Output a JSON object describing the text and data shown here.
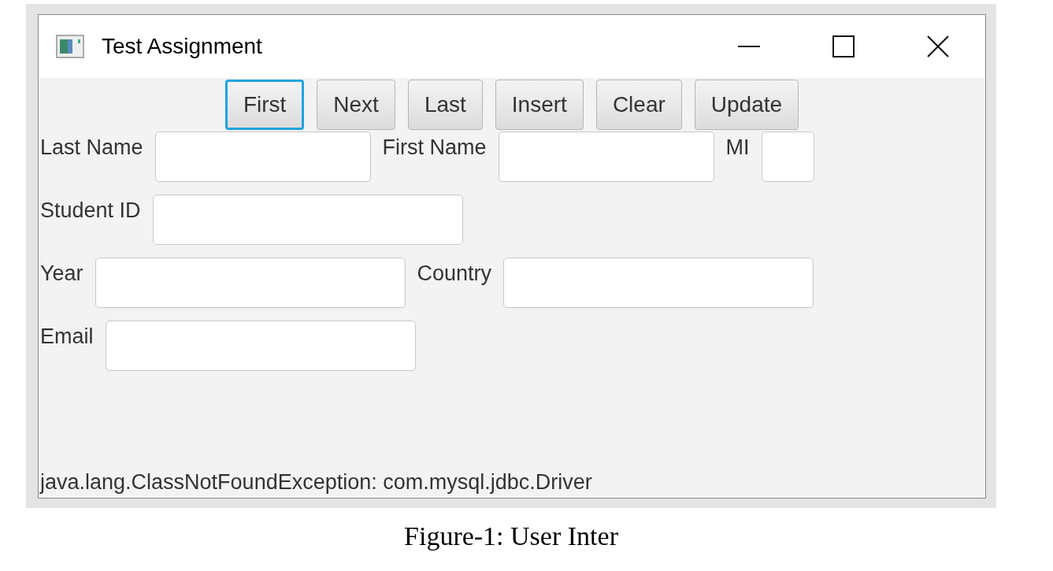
{
  "window": {
    "title": "Test Assignment"
  },
  "buttons": [
    {
      "label": "First",
      "focused": true
    },
    {
      "label": "Next",
      "focused": false
    },
    {
      "label": "Last",
      "focused": false
    },
    {
      "label": "Insert",
      "focused": false
    },
    {
      "label": "Clear",
      "focused": false
    },
    {
      "label": "Update",
      "focused": false
    }
  ],
  "form_rows": [
    [
      {
        "label": "Last Name"
      },
      {
        "label": "First Name"
      },
      {
        "label": "MI"
      }
    ],
    [
      {
        "label": "Student ID"
      }
    ],
    [
      {
        "label": "Year"
      },
      {
        "label": "Country"
      }
    ],
    [
      {
        "label": "Email"
      }
    ]
  ],
  "status_bar": "java.lang.ClassNotFoundException: com.mysql.jdbc.Driver",
  "caption": "Figure-1: User Inter"
}
